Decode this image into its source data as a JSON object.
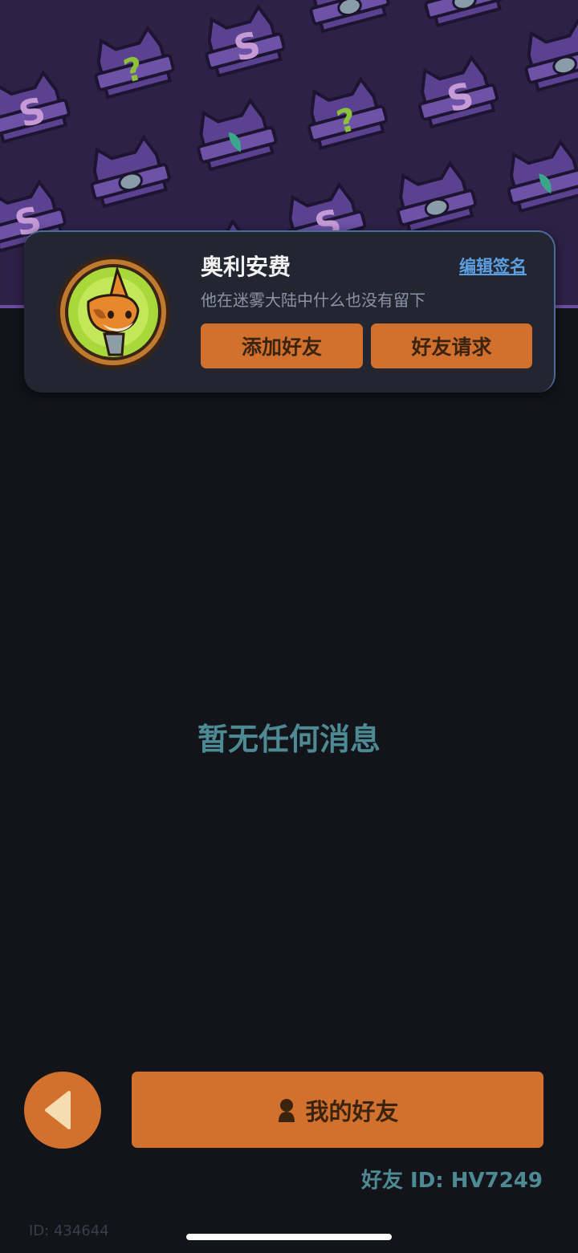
{
  "profile": {
    "name": "奥利安费",
    "edit_signature_label": "编辑签名",
    "signature": "他在迷雾大陆中什么也没有留下",
    "add_friend_label": "添加好友",
    "friend_requests_label": "好友请求"
  },
  "main": {
    "empty_message": "暂无任何消息"
  },
  "footer": {
    "my_friends_label": "我的好友",
    "friend_id_text": "好友 ID: HV7249",
    "user_id_text": "ID: 434644"
  },
  "icons": {
    "back": "chevron-left-icon",
    "person": "person-icon",
    "avatar": "fox-avatar"
  },
  "colors": {
    "background": "#13141a",
    "banner": "#2e2148",
    "card": "#232630",
    "accent_orange": "#d2712d",
    "teal_text": "#4d8a94",
    "link_blue": "#5b9fe0"
  }
}
